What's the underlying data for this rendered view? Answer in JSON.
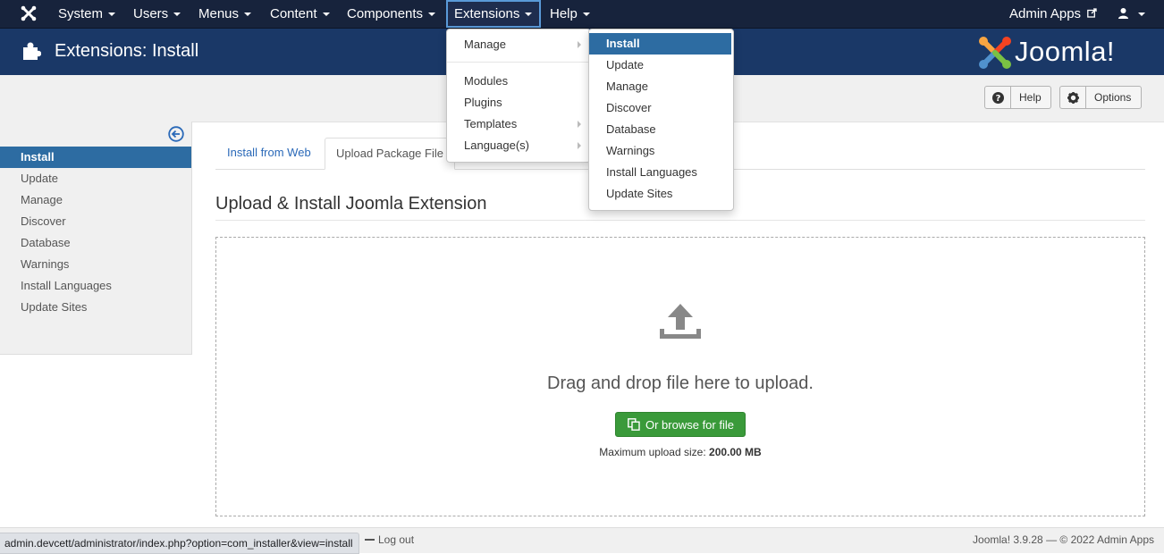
{
  "navbar": {
    "items": [
      "System",
      "Users",
      "Menus",
      "Content",
      "Components",
      "Extensions",
      "Help"
    ],
    "admin_apps": "Admin Apps",
    "active": "Extensions"
  },
  "header": {
    "title": "Extensions: Install",
    "logo": "Joomla!"
  },
  "toolbar": {
    "help_label": "Help",
    "options_label": "Options"
  },
  "sidebar": {
    "items": [
      "Install",
      "Update",
      "Manage",
      "Discover",
      "Database",
      "Warnings",
      "Install Languages",
      "Update Sites"
    ],
    "active": "Install"
  },
  "tabs": {
    "web": "Install from Web",
    "upload": "Upload Package File"
  },
  "main": {
    "section_title": "Upload & Install Joomla Extension",
    "drop_text": "Drag and drop file here to upload.",
    "browse_label": "Or browse for file",
    "max_label": "Maximum upload size:",
    "max_value": "200.00 MB"
  },
  "extensions_menu": {
    "items": [
      "Manage",
      "Modules",
      "Plugins",
      "Templates",
      "Language(s)"
    ]
  },
  "manage_submenu": {
    "items": [
      "Install",
      "Update",
      "Manage",
      "Discover",
      "Database",
      "Warnings",
      "Install Languages",
      "Update Sites"
    ],
    "highlighted": "Install"
  },
  "footer": {
    "logout": "Log out",
    "version": "Joomla! 3.9.28",
    "copyright": "© 2022 Admin Apps"
  },
  "status_url": "admin.devcett/administrator/index.php?option=com_installer&view=install",
  "colors": {
    "navbar": "#17233c",
    "header": "#1a3867",
    "accent": "#2d6ca2",
    "success": "#3a9a3a"
  }
}
